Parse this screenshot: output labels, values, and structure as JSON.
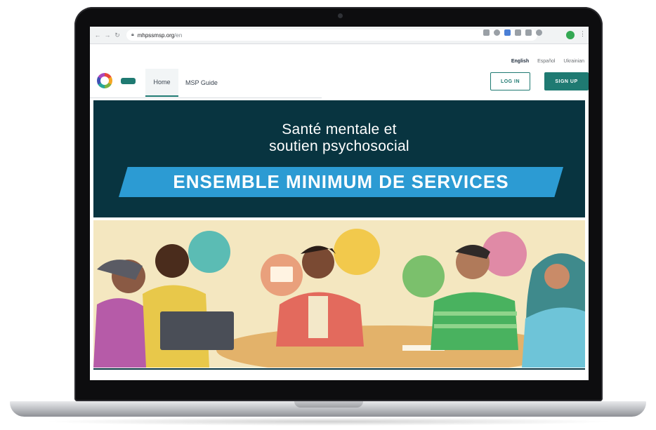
{
  "browser": {
    "back_icon": "back-arrow-icon",
    "forward_icon": "forward-arrow-icon",
    "reload_icon": "reload-icon",
    "url_host": "mhpssmsp.org",
    "url_path": "/en"
  },
  "site": {
    "languages": [
      {
        "label": "English",
        "active": true
      },
      {
        "label": "Español",
        "active": false
      },
      {
        "label": "Ukrainian",
        "active": false
      }
    ],
    "nav": {
      "home_label": "Home",
      "guide_label": "MSP Guide"
    },
    "login_label": "LOG IN",
    "signup_label": "SIGN UP"
  },
  "hero": {
    "title_line1": "Santé mentale et",
    "title_line2": "soutien psychosocial",
    "ribbon": "ENSEMBLE MINIMUM DE SERVICES"
  },
  "colors": {
    "brand_teal": "#1f7a72",
    "hero_dark": "#083440",
    "ribbon_blue": "#2c9bd3",
    "illustration_bg": "#f4e7c0"
  }
}
